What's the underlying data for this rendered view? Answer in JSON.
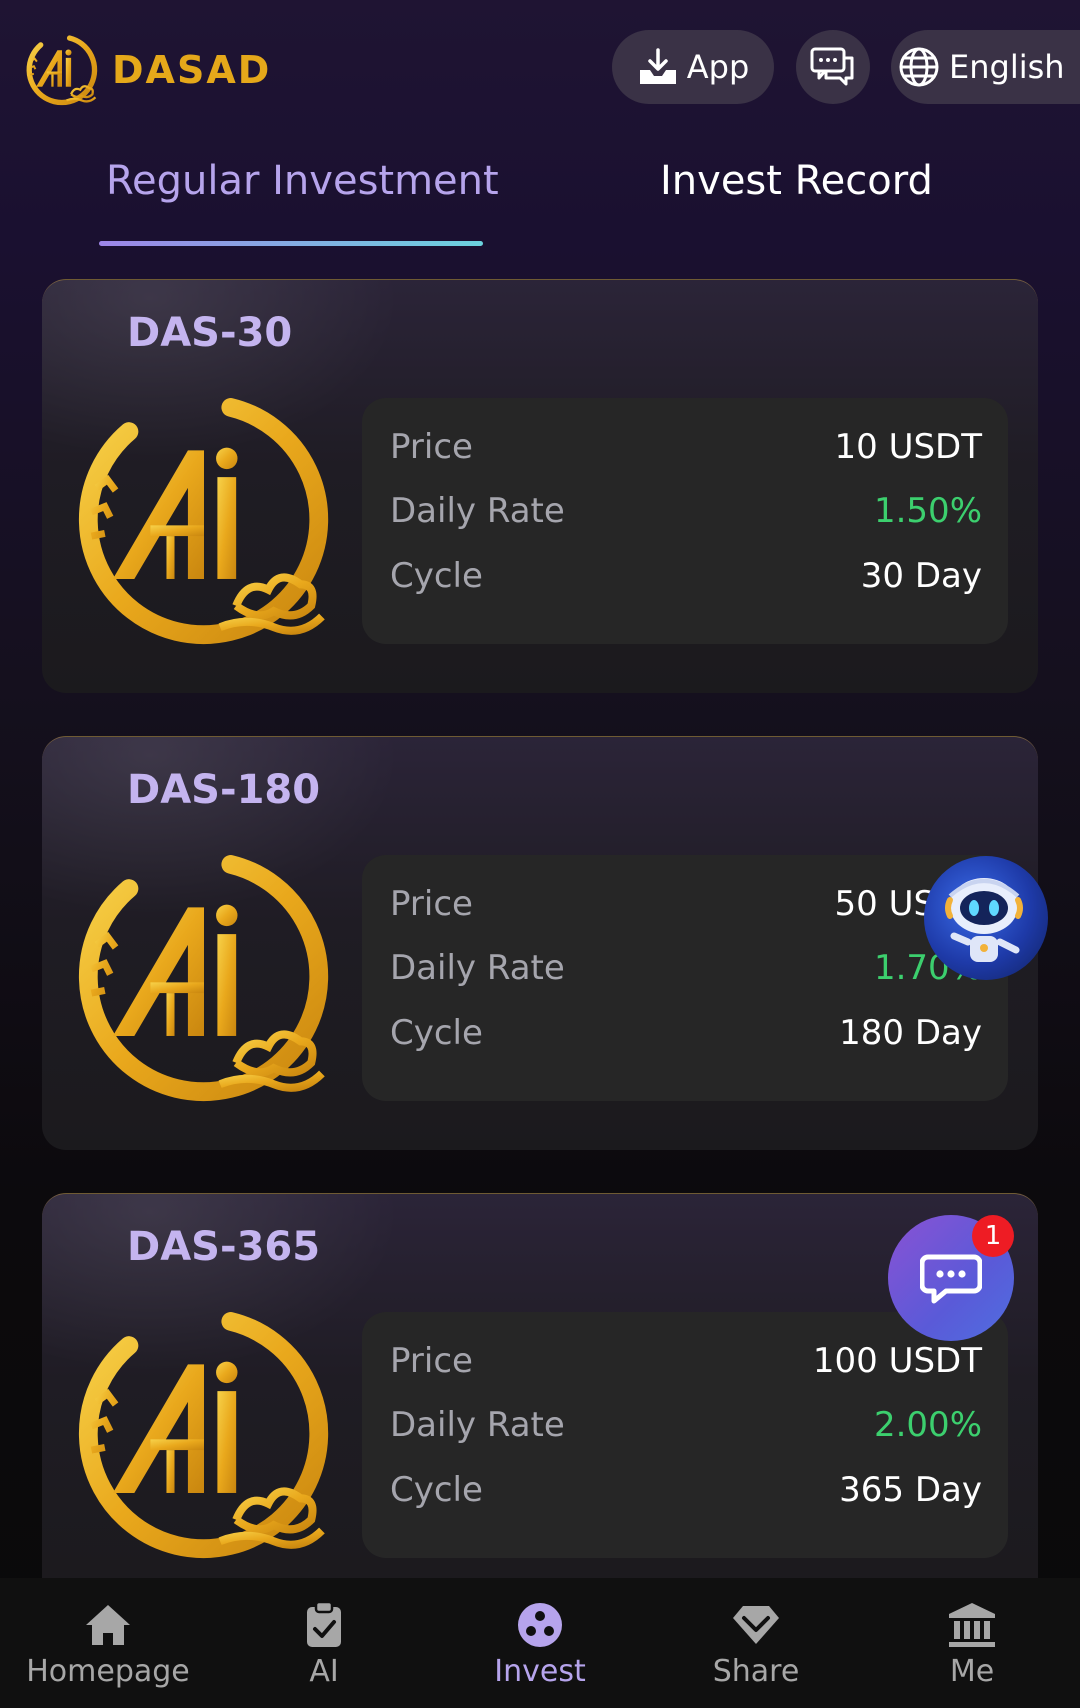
{
  "header": {
    "brand": "DASAD",
    "app_label": "App",
    "language_label": "English"
  },
  "tabs": {
    "regular": "Regular Investment",
    "record": "Invest Record"
  },
  "products": [
    {
      "name": "DAS-30",
      "price_label": "Price",
      "price": "10 USDT",
      "rate_label": "Daily Rate",
      "rate": "1.50%",
      "cycle_label": "Cycle",
      "cycle": "30 Day"
    },
    {
      "name": "DAS-180",
      "price_label": "Price",
      "price": "50 USDT",
      "rate_label": "Daily Rate",
      "rate": "1.70%",
      "cycle_label": "Cycle",
      "cycle": "180 Day"
    },
    {
      "name": "DAS-365",
      "price_label": "Price",
      "price": "100 USDT",
      "rate_label": "Daily Rate",
      "rate": "2.00%",
      "cycle_label": "Cycle",
      "cycle": "365 Day"
    }
  ],
  "chat": {
    "unread_count": "1"
  },
  "nav": {
    "home": "Homepage",
    "ai": "AI",
    "invest": "Invest",
    "share": "Share",
    "me": "Me",
    "active": "invest"
  },
  "colors": {
    "brand_gold": "#e5a81a",
    "accent_purple": "#b6a4ec",
    "rate_green": "#3ccf6e",
    "badge_red": "#ee1c24"
  },
  "icons": [
    "logo-icon",
    "download-icon",
    "chat-icon",
    "globe-icon",
    "robot-icon",
    "message-icon",
    "home-icon",
    "clipboard-icon",
    "dots-icon",
    "diamond-icon",
    "bank-icon"
  ]
}
